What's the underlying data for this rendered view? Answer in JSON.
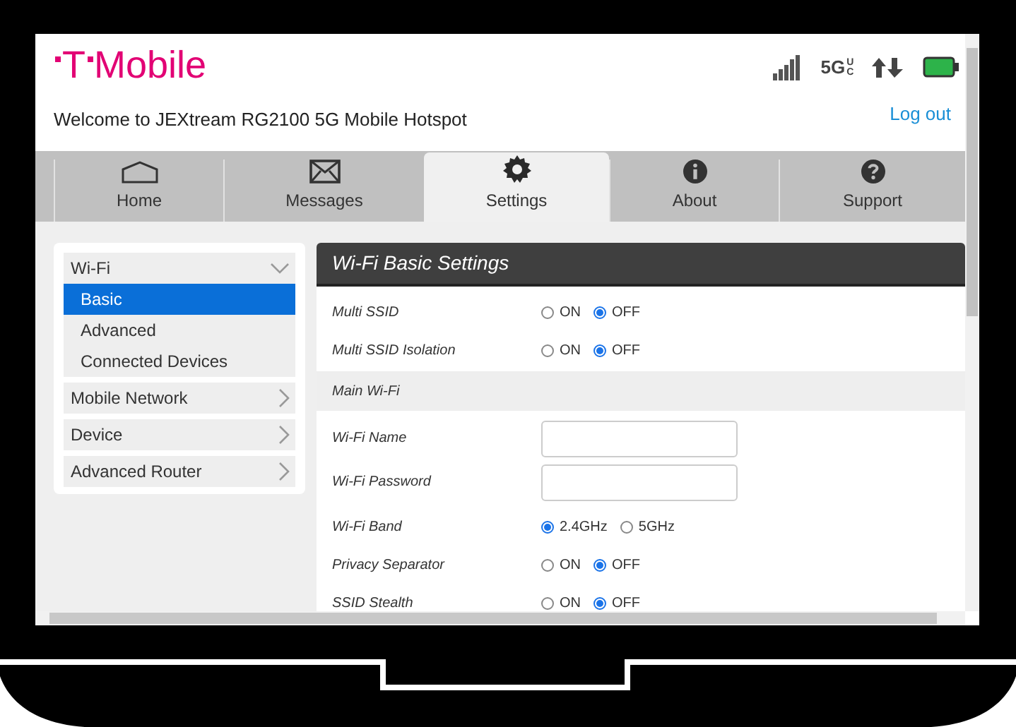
{
  "header": {
    "logo": {
      "mark": "T",
      "word": "Mobile"
    },
    "welcome": "Welcome to JEXtream RG2100 5G Mobile Hotspot",
    "logout": "Log out",
    "network": {
      "main": "5G",
      "sub": "UC"
    }
  },
  "tabs": [
    {
      "label": "Home",
      "selected": false
    },
    {
      "label": "Messages",
      "selected": false
    },
    {
      "label": "Settings",
      "selected": true
    },
    {
      "label": "About",
      "selected": false
    },
    {
      "label": "Support",
      "selected": false
    }
  ],
  "sidebar": {
    "groups": [
      {
        "label": "Wi-Fi",
        "expanded": true,
        "items": [
          {
            "label": "Basic",
            "selected": true
          },
          {
            "label": "Advanced",
            "selected": false
          },
          {
            "label": "Connected Devices",
            "selected": false
          }
        ]
      },
      {
        "label": "Mobile Network",
        "expanded": false
      },
      {
        "label": "Device",
        "expanded": false
      },
      {
        "label": "Advanced Router",
        "expanded": false
      }
    ]
  },
  "panel": {
    "title": "Wi-Fi Basic Settings",
    "rows": [
      {
        "kind": "radio",
        "label": "Multi SSID",
        "options": [
          {
            "label": "ON",
            "selected": false
          },
          {
            "label": "OFF",
            "selected": true
          }
        ]
      },
      {
        "kind": "radio",
        "label": "Multi SSID Isolation",
        "options": [
          {
            "label": "ON",
            "selected": false
          },
          {
            "label": "OFF",
            "selected": true
          }
        ]
      },
      {
        "kind": "section",
        "label": "Main Wi-Fi"
      },
      {
        "kind": "input",
        "label": "Wi-Fi Name"
      },
      {
        "kind": "input",
        "label": "Wi-Fi Password"
      },
      {
        "kind": "radio",
        "label": "Wi-Fi Band",
        "options": [
          {
            "label": "2.4GHz",
            "selected": true
          },
          {
            "label": "5GHz",
            "selected": false
          }
        ]
      },
      {
        "kind": "radio",
        "label": "Privacy Separator",
        "options": [
          {
            "label": "ON",
            "selected": false
          },
          {
            "label": "OFF",
            "selected": true
          }
        ]
      },
      {
        "kind": "radio",
        "label": "SSID Stealth",
        "options": [
          {
            "label": "ON",
            "selected": false
          },
          {
            "label": "OFF",
            "selected": true
          }
        ]
      }
    ]
  }
}
